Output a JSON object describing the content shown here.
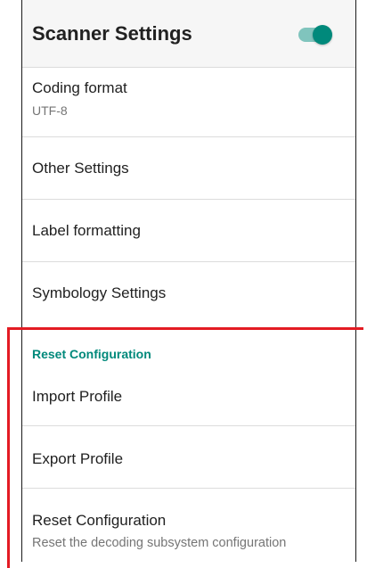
{
  "app_bar": {
    "title": "Scanner Settings",
    "toggle_on": true
  },
  "general": {
    "coding_format": {
      "title": "Coding format",
      "value": "UTF-8"
    },
    "other_settings": {
      "title": "Other Settings"
    },
    "label_formatting": {
      "title": "Label formatting"
    },
    "symbology_settings": {
      "title": "Symbology Settings"
    }
  },
  "reset_section": {
    "header": "Reset Configuration",
    "import_profile": {
      "title": "Import Profile"
    },
    "export_profile": {
      "title": "Export Profile"
    },
    "reset_configuration": {
      "title": "Reset Configuration",
      "summary": "Reset the decoding subsystem configuration"
    }
  },
  "colors": {
    "accent": "#00897b",
    "switch_track": "#80c4bd",
    "highlight": "#e31b23"
  }
}
